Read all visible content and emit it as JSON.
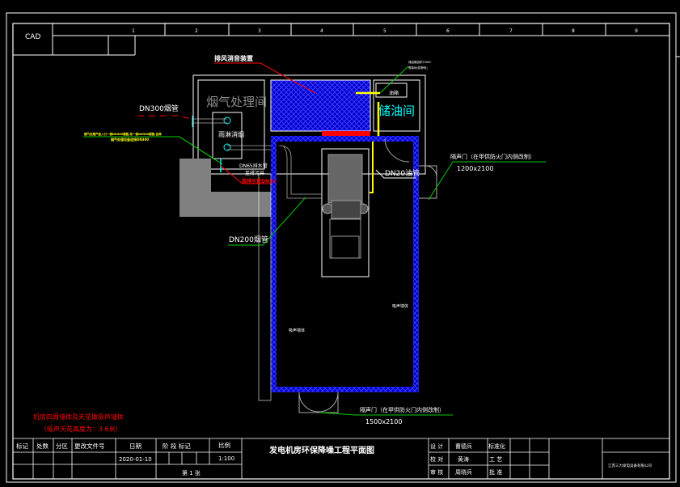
{
  "colors": {
    "background": "#000000",
    "line": "#ffffff",
    "wall": "#0000ff",
    "annotation_red": "#ff0000",
    "leader_green": "#00cc00",
    "oil_yellow": "#ffff00",
    "cyan": "#00ffff",
    "equipment_gray": "#808080"
  },
  "frame": {
    "logo": "CAD",
    "grid_numbers": [
      "1",
      "2",
      "3",
      "4",
      "5",
      "6",
      "7",
      "8",
      "9"
    ]
  },
  "plan": {
    "rooms": {
      "smoke_room": "烟气处理间",
      "oil_room": "储油间",
      "oil_tank": "油箱",
      "spray_unit": "雨淋消烟"
    },
    "labels": {
      "exhaust_silencer": "排风消音装置",
      "dn300": "DN300烟管",
      "yellow_note_1": "烟气处理产品入口一侧DN300烟管,另一侧DN300烟管,含阀",
      "yellow_note_2": "烟气处理设备连接DN300",
      "dn65_1": "DN65排水管",
      "dn65_2": "至排污井",
      "drain_red": "接排水管DN32",
      "dn20": "DN20油管",
      "dn200": "DN200烟管",
      "oil_tank_note_1": "储油箱容积1000L",
      "oil_tank_note_2": "需接地(防静电)",
      "door1_title": "隔声门（在甲供防火门内侧改制）",
      "door1_size": "1200x2100",
      "door2_title": "隔声门（在甲供防火门内侧改制）",
      "door2_size": "1500x2100",
      "wall_label_right": "吸声墙体",
      "wall_label_left": "吸声墙体",
      "note_line_1": "机房四周墙体及天花做吸声墙体",
      "note_line_2": "（吸声天花高度为：3.6米）"
    }
  },
  "title_block": {
    "headers": [
      "标记",
      "处数",
      "分区",
      "更改文件号",
      "日期",
      "阶 段 标记",
      "比例"
    ],
    "date": "2020-01-10",
    "scale": "1:100",
    "sheet": "第 1 张",
    "drawing_title": "发电机房环保降噪工程平面图",
    "roles": [
      {
        "role": "设 计",
        "name": "曹德兵",
        "role2": "标准化"
      },
      {
        "role": "校 对",
        "name": "黄涛",
        "role2": "工 艺"
      },
      {
        "role": "审 核",
        "name": "周晓兵",
        "role2": "批 准"
      }
    ],
    "company": "江苏三力发电设备有限公司"
  }
}
